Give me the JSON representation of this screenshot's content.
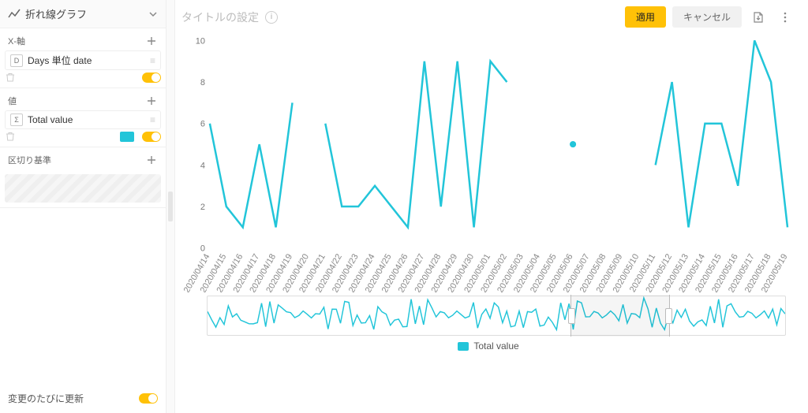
{
  "sidebar": {
    "chartType": "折れ線グラフ",
    "xaxis": {
      "title": "X-軸",
      "field": {
        "badge": "D",
        "label": "Days 単位 date"
      },
      "switchOn": true
    },
    "value": {
      "title": "値",
      "field": {
        "badge": "Σ",
        "label": "Total value"
      },
      "switchOn": true
    },
    "split": {
      "title": "区切り基準"
    },
    "footer": {
      "label": "変更のたびに更新",
      "switchOn": true
    }
  },
  "topbar": {
    "titlePlaceholder": "タイトルの設定",
    "apply": "適用",
    "cancel": "キャンセル"
  },
  "legend": {
    "series": "Total value"
  },
  "colors": {
    "accent": "#22C5D9"
  },
  "chart_data": {
    "type": "line",
    "xlabel": "",
    "ylabel": "",
    "ylim": [
      0,
      10
    ],
    "yticks": [
      0,
      2,
      4,
      6,
      8,
      10
    ],
    "categories": [
      "2020/04/14",
      "2020/04/15",
      "2020/04/16",
      "2020/04/17",
      "2020/04/18",
      "2020/04/19",
      "2020/04/20",
      "2020/04/21",
      "2020/04/22",
      "2020/04/23",
      "2020/04/24",
      "2020/04/25",
      "2020/04/26",
      "2020/04/27",
      "2020/04/28",
      "2020/04/29",
      "2020/04/30",
      "2020/05/01",
      "2020/05/02",
      "2020/05/03",
      "2020/05/04",
      "2020/05/05",
      "2020/05/06",
      "2020/05/07",
      "2020/05/08",
      "2020/05/09",
      "2020/05/10",
      "2020/05/11",
      "2020/05/12",
      "2020/05/13",
      "2020/05/14",
      "2020/05/15",
      "2020/05/16",
      "2020/05/17",
      "2020/05/18",
      "2020/05/19"
    ],
    "series": [
      {
        "name": "Total value",
        "values": [
          6,
          2,
          1,
          5,
          1,
          7,
          null,
          6,
          2,
          2,
          3,
          2,
          1,
          9,
          2,
          9,
          1,
          9,
          8,
          null,
          null,
          null,
          5,
          null,
          null,
          null,
          null,
          4,
          8,
          1,
          6,
          6,
          3,
          10,
          8,
          1
        ]
      }
    ],
    "isolated_points": [
      {
        "index": 22,
        "value": 5
      }
    ],
    "overview_selection": {
      "start_index": 22,
      "end_index": 28
    }
  }
}
